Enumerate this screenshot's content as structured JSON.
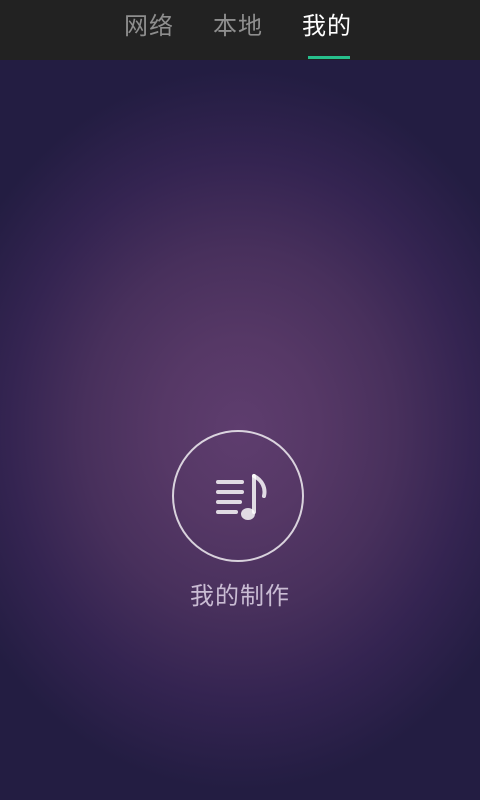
{
  "tabs": [
    {
      "label": "网络",
      "active": false
    },
    {
      "label": "本地",
      "active": false
    },
    {
      "label": "我的",
      "active": true
    }
  ],
  "colors": {
    "accent": "#27c08c",
    "topbar": "#222222",
    "background": "#231d42"
  },
  "main": {
    "icon": "music-list-icon",
    "label": "我的制作"
  }
}
